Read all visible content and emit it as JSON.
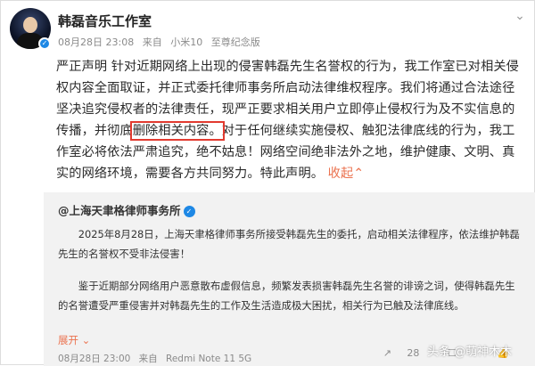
{
  "post": {
    "username": "韩磊音乐工作室",
    "date": "08月28日 23:08",
    "source_prefix": "来自",
    "device": "小米10",
    "edition": "至尊纪念版",
    "content_part1": "严正声明 针对近期网络上出现的侵害韩磊先生名誉权的行为，我工作室已对相关侵权内容全面取证，并正式委托律师事务所启动法律维权程序。我们将通过合法途径坚决追究侵权者的法律责任，现严正要求相关用户立即停止侵权行为及不实信息的传播，并彻底",
    "content_highlight": "删除相关内容。",
    "content_part2": "对于任何继续实施侵权、触犯法律底线的行为，我工作室必将依法严肃追究，绝不姑息！网络空间绝非法外之地，维护健康、文明、真实的网络环境，需要各方共同努力。特此声明。",
    "collapse_label": "收起",
    "collapse_icon": "chevron-up-icon"
  },
  "repost": {
    "account_name": "@上海天聿格律师事务所",
    "paragraph1": "2025年8月28日，上海天聿格律师事务所接受韩磊先生的委托，启动相关法律程序，依法维护韩磊先生的名誉权不受非法侵害！",
    "paragraph2": "鉴于近期部分网络用户恶意散布虚假信息，频繁发表损害韩磊先生名誉的诽谤之词，使得韩磊先生的名誉遭受严重侵害并对韩磊先生的工作及生活造成极大困扰，相关行为已触及法律底线。",
    "expand_label": "展开",
    "date": "08月28日 23:00",
    "device": "Redmi Note 11 5G",
    "repost_count": "28",
    "comment_count": "",
    "like_count": ""
  },
  "watermark": "头条 @萌神木木",
  "colors": {
    "highlight_border": "#e23a2f",
    "link_orange": "#eb7350",
    "verified_blue": "#1e88e5",
    "repost_bg": "#f2f2f2"
  }
}
